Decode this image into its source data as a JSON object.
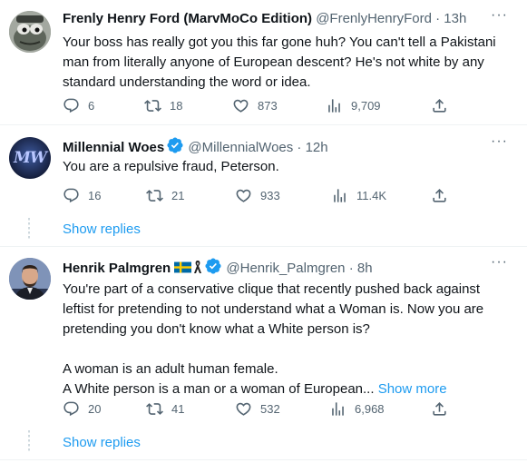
{
  "tweets": [
    {
      "name": "Frenly Henry Ford (MarvMoCo Edition)",
      "handle": "@FrenlyHenryFord",
      "dot": "·",
      "time": "13h",
      "text_lines": [
        "Your boss has really got you this far gone huh? You can't tell a Pakistani",
        "man from literally anyone of European descent? He's not white by any",
        "standard understanding the word or idea."
      ],
      "replies": "6",
      "retweets": "18",
      "likes": "873",
      "views": "9,709"
    },
    {
      "name": "Millennial Woes",
      "handle": "@MillennialWoes",
      "dot": "·",
      "time": "12h",
      "avatar_text": "MW",
      "text_lines": [
        "You are a repulsive fraud, Peterson."
      ],
      "replies": "16",
      "retweets": "21",
      "likes": "933",
      "views": "11.4K",
      "show_replies": "Show replies"
    },
    {
      "name": "Henrik Palmgren",
      "handle": "@Henrik_Palmgren",
      "dot": "·",
      "time": "8h",
      "text_lines": [
        "You're part of a conservative clique that recently pushed back against",
        "leftist for pretending to not understand what a Woman is. Now you are",
        "pretending you don't know what a White person is?",
        "",
        "A woman is an adult human female.",
        "A White person is a man or a woman of European..."
      ],
      "show_more": "Show more",
      "replies": "20",
      "retweets": "41",
      "likes": "532",
      "views": "6,968",
      "show_replies": "Show replies"
    }
  ],
  "colors": {
    "text": "#0f1419",
    "secondary": "#536471",
    "accent": "#1d9bf0",
    "divider": "#eff3f4"
  },
  "icons": [
    "reply-icon",
    "retweet-icon",
    "like-icon",
    "views-icon",
    "share-icon",
    "verified-badge-icon",
    "more-icon"
  ]
}
